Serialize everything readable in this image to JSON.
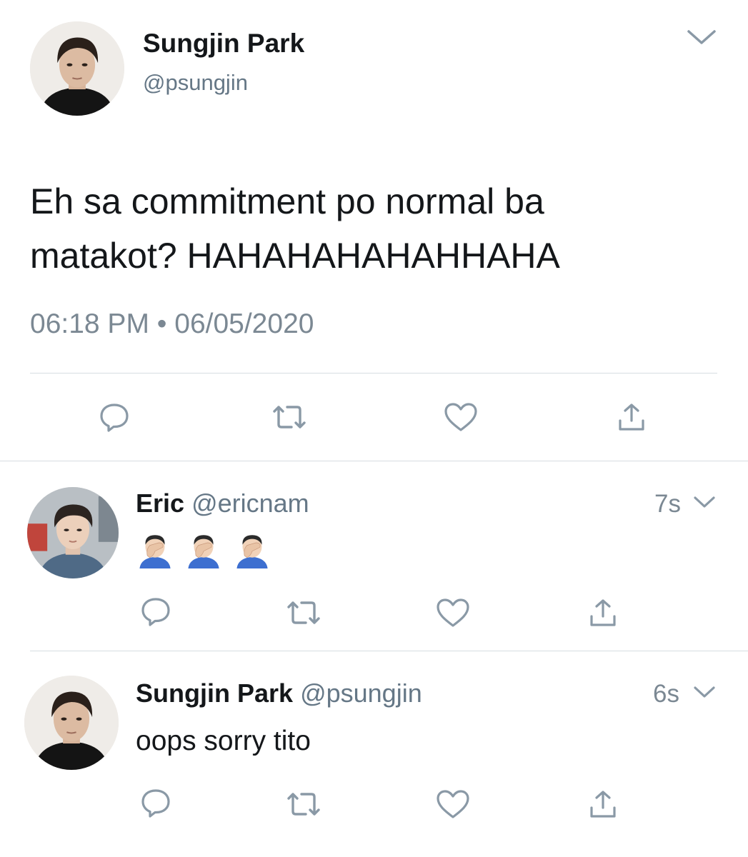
{
  "main_tweet": {
    "author_name": "Sungjin Park",
    "author_handle": "@psungjin",
    "text_line1": "Eh sa commitment po normal ba",
    "text_line2": "matakot? HAHAHAHAHAHHAHA",
    "timestamp": "06:18 PM • 06/05/2020"
  },
  "replies": [
    {
      "author_name": "Eric",
      "author_handle": "@ericnam",
      "time": "7s",
      "emoji_count": 3
    },
    {
      "author_name": "Sungjin Park",
      "author_handle": "@psungjin",
      "time": "6s",
      "text": "oops sorry tito"
    }
  ],
  "colors": {
    "icon_gray": "#8a99a6",
    "text_dark": "#14171a",
    "text_muted": "#7b8893",
    "divider": "#d7dde2"
  },
  "icons": [
    "reply-icon",
    "retweet-icon",
    "like-icon",
    "share-icon",
    "chevron-down-icon",
    "facepalm-emoji"
  ]
}
